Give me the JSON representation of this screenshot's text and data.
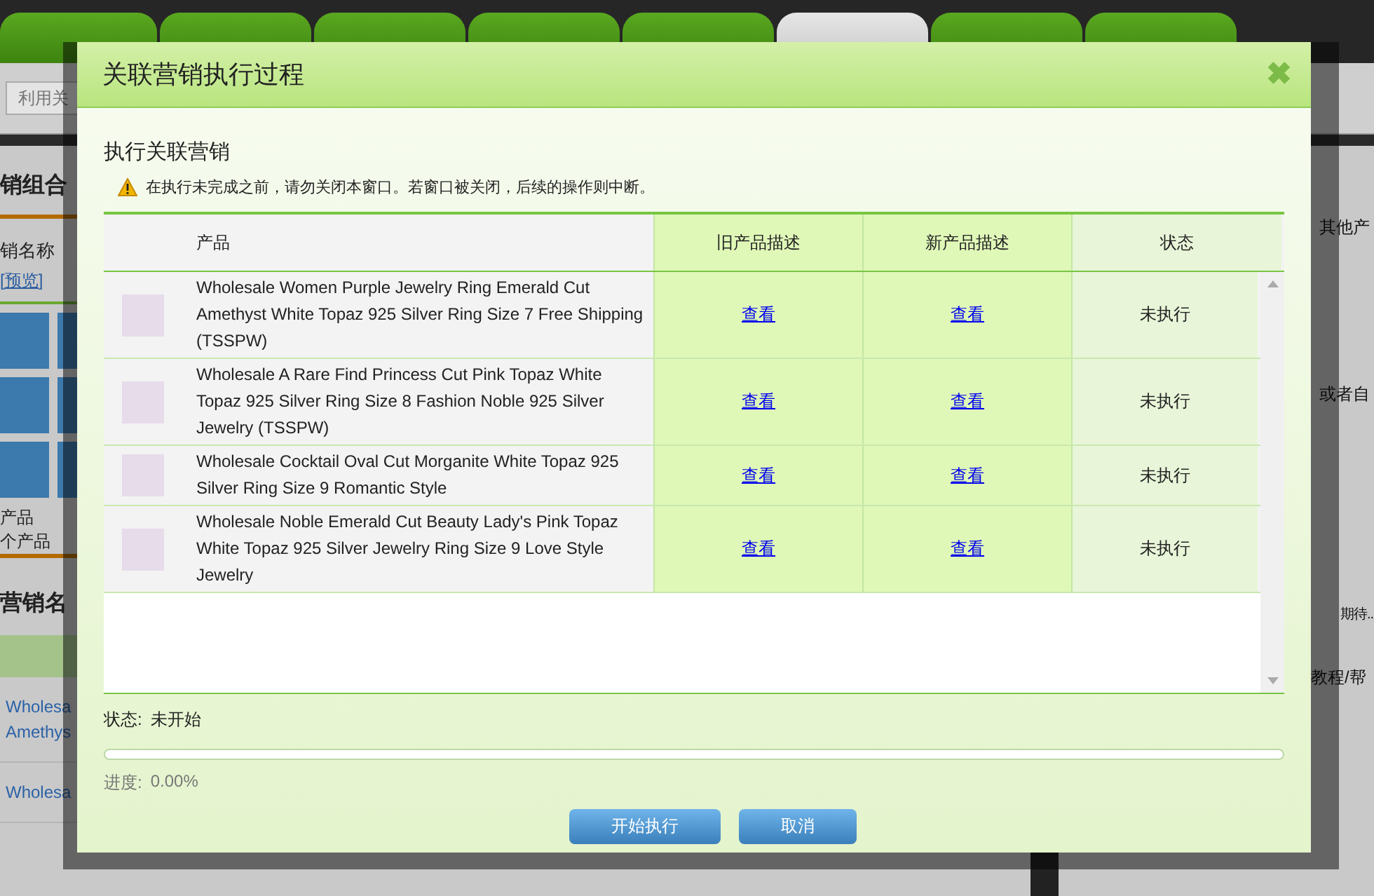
{
  "background": {
    "tabs": [
      {
        "selected": false
      },
      {
        "selected": false
      },
      {
        "selected": false
      },
      {
        "selected": false
      },
      {
        "selected": false
      },
      {
        "selected": true
      },
      {
        "selected": false
      },
      {
        "selected": false
      }
    ],
    "search": {
      "placeholder": "利用关"
    },
    "left": {
      "heading": "销组合",
      "name_label": "销名称",
      "preview_link": "[预览]",
      "count_lines": [
        "产品",
        "个产品"
      ],
      "list_heading": "营销名",
      "list_items": [
        [
          "Wholesa",
          "Amethys"
        ],
        [
          "Wholesa"
        ]
      ]
    },
    "right": {
      "texts": [
        "其他产",
        "或者自",
        "期待..",
        "教程/帮"
      ]
    }
  },
  "dialog": {
    "title": "关联营销执行过程",
    "close": "✖",
    "section_title": "执行关联营销",
    "warning": "在执行未完成之前，请勿关闭本窗口。若窗口被关闭，后续的操作则中断。",
    "table": {
      "columns": [
        "产品",
        "旧产品描述",
        "新产品描述",
        "状态"
      ],
      "rows": [
        {
          "product": "Wholesale Women Purple Jewelry Ring Emerald Cut Amethyst White Topaz 925 Silver Ring Size 7 Free Shipping (TSSPW)",
          "old_desc": "查看",
          "new_desc": "查看",
          "status": "未执行"
        },
        {
          "product": "Wholesale A Rare Find Princess Cut Pink Topaz White Topaz 925 Silver Ring Size 8 Fashion Noble 925 Silver Jewelry (TSSPW)",
          "old_desc": "查看",
          "new_desc": "查看",
          "status": "未执行"
        },
        {
          "product": "Wholesale Cocktail Oval Cut Morganite White Topaz 925 Silver Ring Size 9 Romantic Style",
          "old_desc": "查看",
          "new_desc": "查看",
          "status": "未执行"
        },
        {
          "product": "Wholesale Noble Emerald Cut Beauty Lady's Pink Topaz White Topaz 925 Silver Jewelry Ring Size 9 Love Style Jewelry",
          "old_desc": "查看",
          "new_desc": "查看",
          "status": "未执行"
        }
      ]
    },
    "status_label": "状态:",
    "status_value": "未开始",
    "progress": {
      "level": 0,
      "label": "进度:",
      "reading": "0.00%"
    },
    "buttons": [
      "开始执行",
      "取消"
    ]
  }
}
